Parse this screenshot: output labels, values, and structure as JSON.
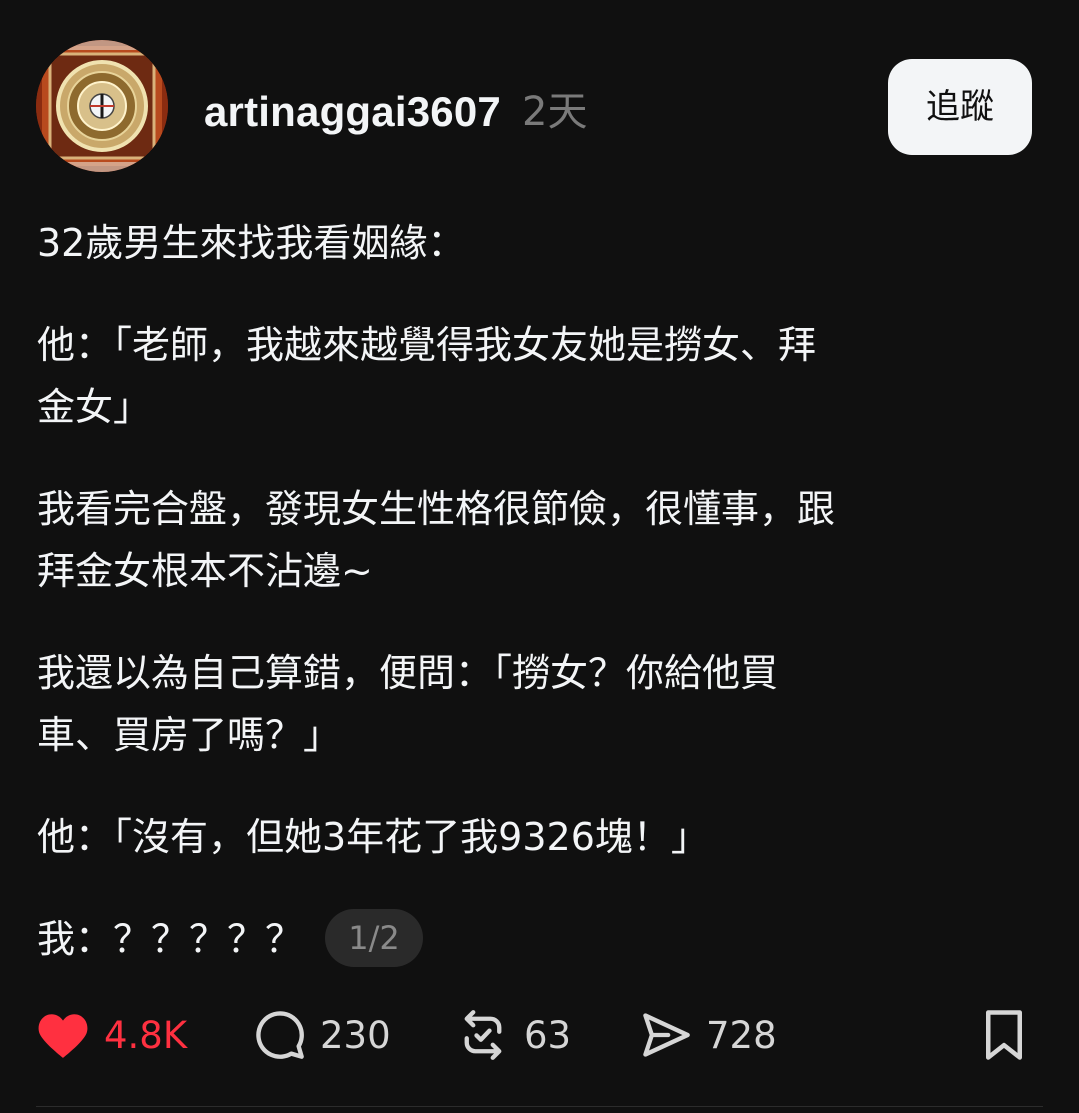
{
  "post": {
    "username": "artinaggai3607",
    "time": "2天",
    "follow_label": "追蹤",
    "paragraphs": [
      "32歲男生來找我看姻緣：",
      "他：「老師，我越來越覺得我女友她是撈女、拜\n金女」",
      "我看完合盤，發現女生性格很節儉，很懂事，跟\n拜金女根本不沾邊~",
      "我還以為自己算錯，便問：「撈女？你給他買\n車、買房了嗎？」",
      "他：「沒有，但她3年花了我9326塊！」",
      "我：？？？？？"
    ],
    "page_indicator": "1/2"
  },
  "actions": {
    "likes": "4.8K",
    "comments": "230",
    "reposts": "63",
    "shares": "728"
  },
  "colors": {
    "background": "#101010",
    "text": "#f3f5f7",
    "muted": "#7a7a7a",
    "like": "#ff3040"
  },
  "icons": {
    "like": "heart-icon",
    "comment": "comment-bubble-icon",
    "repost": "repost-icon",
    "share": "share-send-icon",
    "save": "bookmark-icon"
  }
}
